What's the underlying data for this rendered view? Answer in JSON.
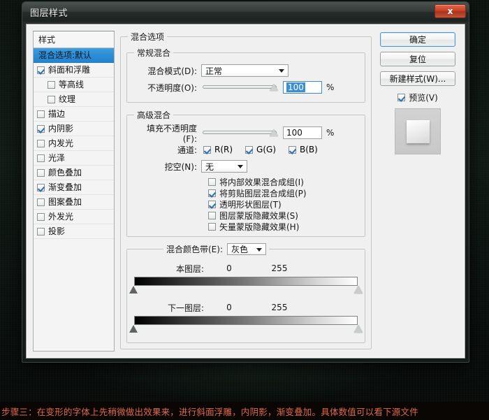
{
  "window": {
    "title": "图层样式",
    "close_label": "x"
  },
  "sidebar": {
    "header": "样式",
    "items": [
      {
        "label": "混合选项:默认",
        "checkbox": false,
        "checked": false,
        "selected": true,
        "indent": false
      },
      {
        "label": "斜面和浮雕",
        "checkbox": true,
        "checked": true,
        "selected": false,
        "indent": false
      },
      {
        "label": "等高线",
        "checkbox": true,
        "checked": false,
        "selected": false,
        "indent": true
      },
      {
        "label": "纹理",
        "checkbox": true,
        "checked": false,
        "selected": false,
        "indent": true
      },
      {
        "label": "描边",
        "checkbox": true,
        "checked": false,
        "selected": false,
        "indent": false
      },
      {
        "label": "内阴影",
        "checkbox": true,
        "checked": true,
        "selected": false,
        "indent": false
      },
      {
        "label": "内发光",
        "checkbox": true,
        "checked": false,
        "selected": false,
        "indent": false
      },
      {
        "label": "光泽",
        "checkbox": true,
        "checked": false,
        "selected": false,
        "indent": false
      },
      {
        "label": "颜色叠加",
        "checkbox": true,
        "checked": false,
        "selected": false,
        "indent": false
      },
      {
        "label": "渐变叠加",
        "checkbox": true,
        "checked": true,
        "selected": false,
        "indent": false
      },
      {
        "label": "图案叠加",
        "checkbox": true,
        "checked": false,
        "selected": false,
        "indent": false
      },
      {
        "label": "外发光",
        "checkbox": true,
        "checked": false,
        "selected": false,
        "indent": false
      },
      {
        "label": "投影",
        "checkbox": true,
        "checked": false,
        "selected": false,
        "indent": false
      }
    ]
  },
  "main": {
    "group_title": "混合选项",
    "general": {
      "title": "常规混合",
      "blend_mode_label": "混合模式(D):",
      "blend_mode_value": "正常",
      "opacity_label": "不透明度(O):",
      "opacity_value": "100",
      "opacity_unit": "%"
    },
    "advanced": {
      "title": "高级混合",
      "fill_opacity_label": "填充不透明度(F):",
      "fill_opacity_value": "100",
      "fill_opacity_unit": "%",
      "channels_label": "通道:",
      "channels": [
        {
          "label": "R(R)",
          "checked": true
        },
        {
          "label": "G(G)",
          "checked": true
        },
        {
          "label": "B(B)",
          "checked": true
        }
      ],
      "knockout_label": "挖空(N):",
      "knockout_value": "无",
      "options": [
        {
          "label": "将内部效果混合成组(I)",
          "checked": false
        },
        {
          "label": "将剪贴图层混合成组(P)",
          "checked": true
        },
        {
          "label": "透明形状图层(T)",
          "checked": true
        },
        {
          "label": "图层蒙版隐藏效果(S)",
          "checked": false
        },
        {
          "label": "矢量蒙版隐藏效果(H)",
          "checked": false
        }
      ]
    },
    "blend_if": {
      "title": "混合颜色带(E):",
      "channel_value": "灰色",
      "this_layer": {
        "label": "本图层:",
        "min": "0",
        "max": "255"
      },
      "underlying_layer": {
        "label": "下一图层:",
        "min": "0",
        "max": "255"
      }
    }
  },
  "buttons": {
    "ok": "确定",
    "reset": "复位",
    "new_style": "新建样式(W)...",
    "preview_label": "预览(V)",
    "preview_checked": true
  },
  "caption": {
    "text": "步骤三：在变形的字体上先稍微做出效果来，进行斜面浮雕，内阴影，渐变叠加。具体数值可以看下源文件"
  },
  "colors": {
    "selection": "#2b8ed6",
    "close_button": "#c94327",
    "caption_text": "#e0694a",
    "dialog_bg": "#f0f0f0"
  }
}
